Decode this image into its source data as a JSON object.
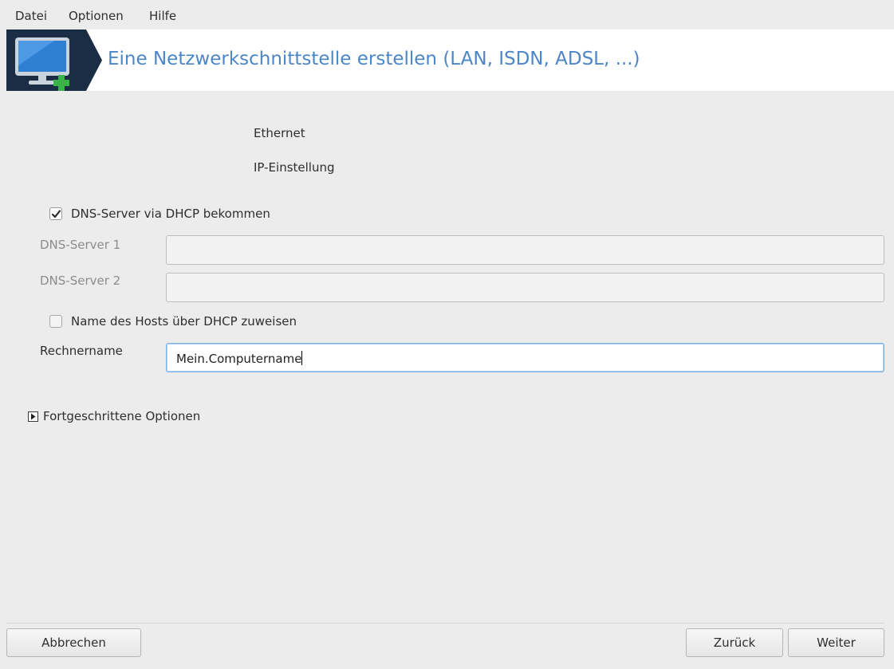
{
  "menu": {
    "file": "Datei",
    "options": "Optionen",
    "help": "Hilfe"
  },
  "banner": {
    "title": "Eine Netzwerkschnittstelle erstellen (LAN, ISDN, ADSL, ...)",
    "icon": "network-computer-add-icon"
  },
  "info": {
    "connection_type": "Ethernet",
    "section": "IP-Einstellung"
  },
  "dns_dhcp": {
    "label": "DNS-Server via DHCP bekommen",
    "checked": true
  },
  "dns1": {
    "label": "DNS-Server 1",
    "value": ""
  },
  "dns2": {
    "label": "DNS-Server 2",
    "value": ""
  },
  "host_dhcp": {
    "label": "Name des Hosts über DHCP zuweisen",
    "checked": false
  },
  "hostname": {
    "label": "Rechnername",
    "value": "Mein.Computername"
  },
  "advanced": {
    "label": "Fortgeschrittene Optionen"
  },
  "buttons": {
    "cancel": "Abbrechen",
    "back": "Zurück",
    "next": "Weiter"
  },
  "colors": {
    "accent": "#4b86c9",
    "window_bg": "#ececec"
  }
}
